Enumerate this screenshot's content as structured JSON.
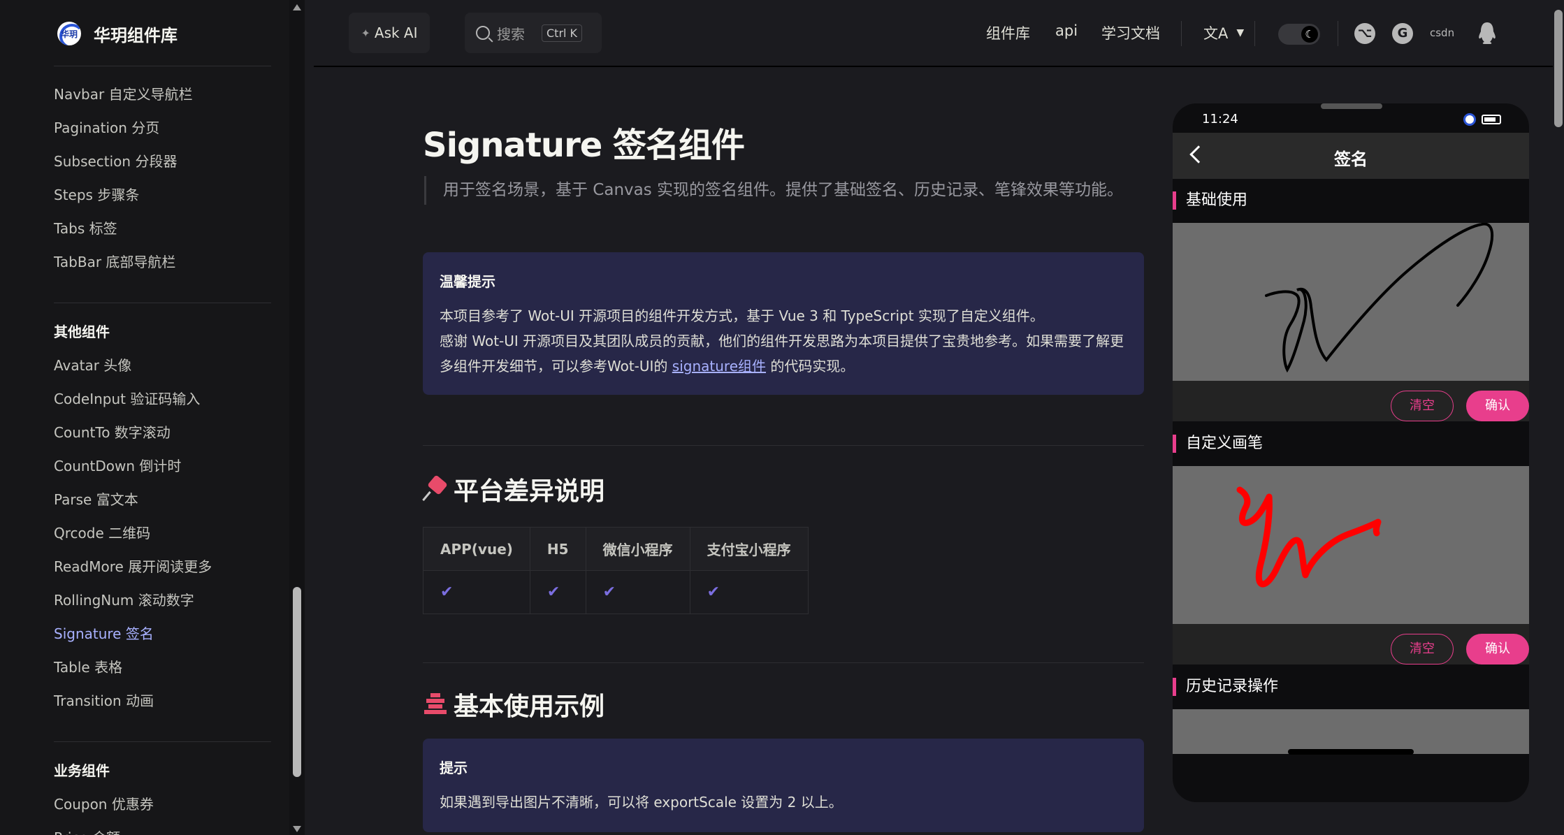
{
  "brand": {
    "name": "华玥组件库",
    "logo_text": "华玥"
  },
  "sidebar": {
    "items_top": [
      "Navbar 自定义导航栏",
      "Pagination 分页",
      "Subsection 分段器",
      "Steps 步骤条",
      "Tabs 标签",
      "TabBar 底部导航栏"
    ],
    "group_other": "其他组件",
    "items_other": [
      "Avatar 头像",
      "CodeInput 验证码输入",
      "CountTo 数字滚动",
      "CountDown 倒计时",
      "Parse 富文本",
      "Qrcode 二维码",
      "ReadMore 展开阅读更多",
      "RollingNum 滚动数字",
      "Signature 签名",
      "Table 表格",
      "Transition 动画"
    ],
    "group_business": "业务组件",
    "items_business": [
      "Coupon 优惠券",
      "Price 金额"
    ],
    "active": "Signature 签名"
  },
  "topbar": {
    "ask_ai": "Ask AI",
    "search_placeholder": "搜索",
    "search_kbd": "Ctrl K",
    "nav": [
      "组件库",
      "api",
      "学习文档"
    ],
    "lang_icon": "translate-icon",
    "social_csdn": "csdn"
  },
  "doc": {
    "title": "Signature 签名组件",
    "lead": "用于签名场景，基于 Canvas 实现的签名组件。提供了基础签名、历史记录、笔锋效果等功能。",
    "tip1": {
      "title": "温馨提示",
      "line1": "本项目参考了 Wot-UI 开源项目的组件开发方式，基于 Vue 3 和 TypeScript 实现了自定义组件。",
      "line2": "感谢 Wot-UI 开源项目及其团队成员的贡献，他们的组件开发思路为本项目提供了宝贵地参考。如果需要了解更多组件开发细节，可以参考Wot-UI的",
      "link": "signature组件",
      "line2_end": "的代码实现。"
    },
    "section_platform": "平台差异说明",
    "platform_table": {
      "headers": [
        "APP(vue)",
        "H5",
        "微信小程序",
        "支付宝小程序"
      ],
      "values": [
        "✔",
        "✔",
        "✔",
        "✔"
      ]
    },
    "section_basic": "基本使用示例",
    "tip2": {
      "title": "提示",
      "text": "如果遇到导出图片不清晰，可以将 exportScale 设置为 2 以上。"
    }
  },
  "phone": {
    "time": "11:24",
    "title": "签名",
    "demo1": "基础使用",
    "demo2": "自定义画笔",
    "demo3": "历史记录操作",
    "clear": "清空",
    "confirm": "确认",
    "pen_color_1": "#000000",
    "pen_color_2": "#ff0000"
  }
}
